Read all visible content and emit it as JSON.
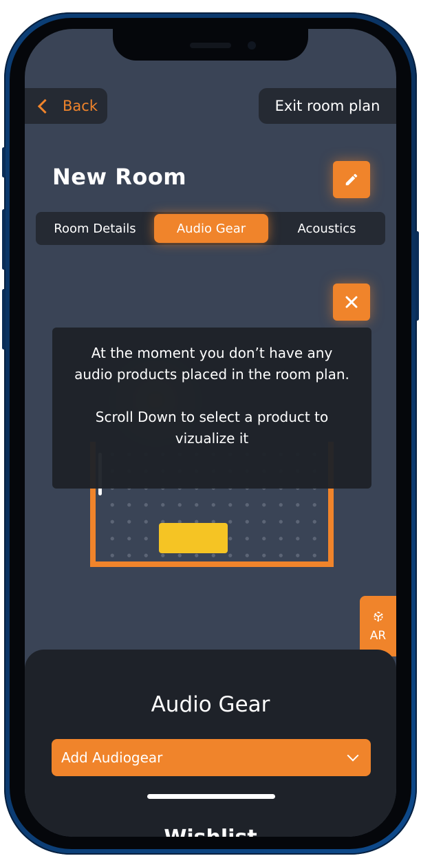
{
  "header": {
    "back_label": "Back",
    "exit_label": "Exit room plan"
  },
  "room": {
    "title": "New Room"
  },
  "tabs": [
    {
      "label": "Room Details",
      "active": false
    },
    {
      "label": "Audio Gear",
      "active": true
    },
    {
      "label": "Acoustics",
      "active": false
    }
  ],
  "tooltip": {
    "line1": "At the moment you don’t have any audio products placed in the room plan.",
    "line2": "Scroll Down to select a product to vizualize it"
  },
  "ar_button": {
    "label": "AR",
    "icon": "ar-cube-icon"
  },
  "sheet": {
    "title": "Audio Gear",
    "dropdown_label": "Add Audiogear",
    "next_section_title": "Wishlist"
  },
  "colors": {
    "accent": "#f0842b",
    "background": "#3a4456",
    "panel": "#1e2229",
    "product": "#f5c424"
  }
}
